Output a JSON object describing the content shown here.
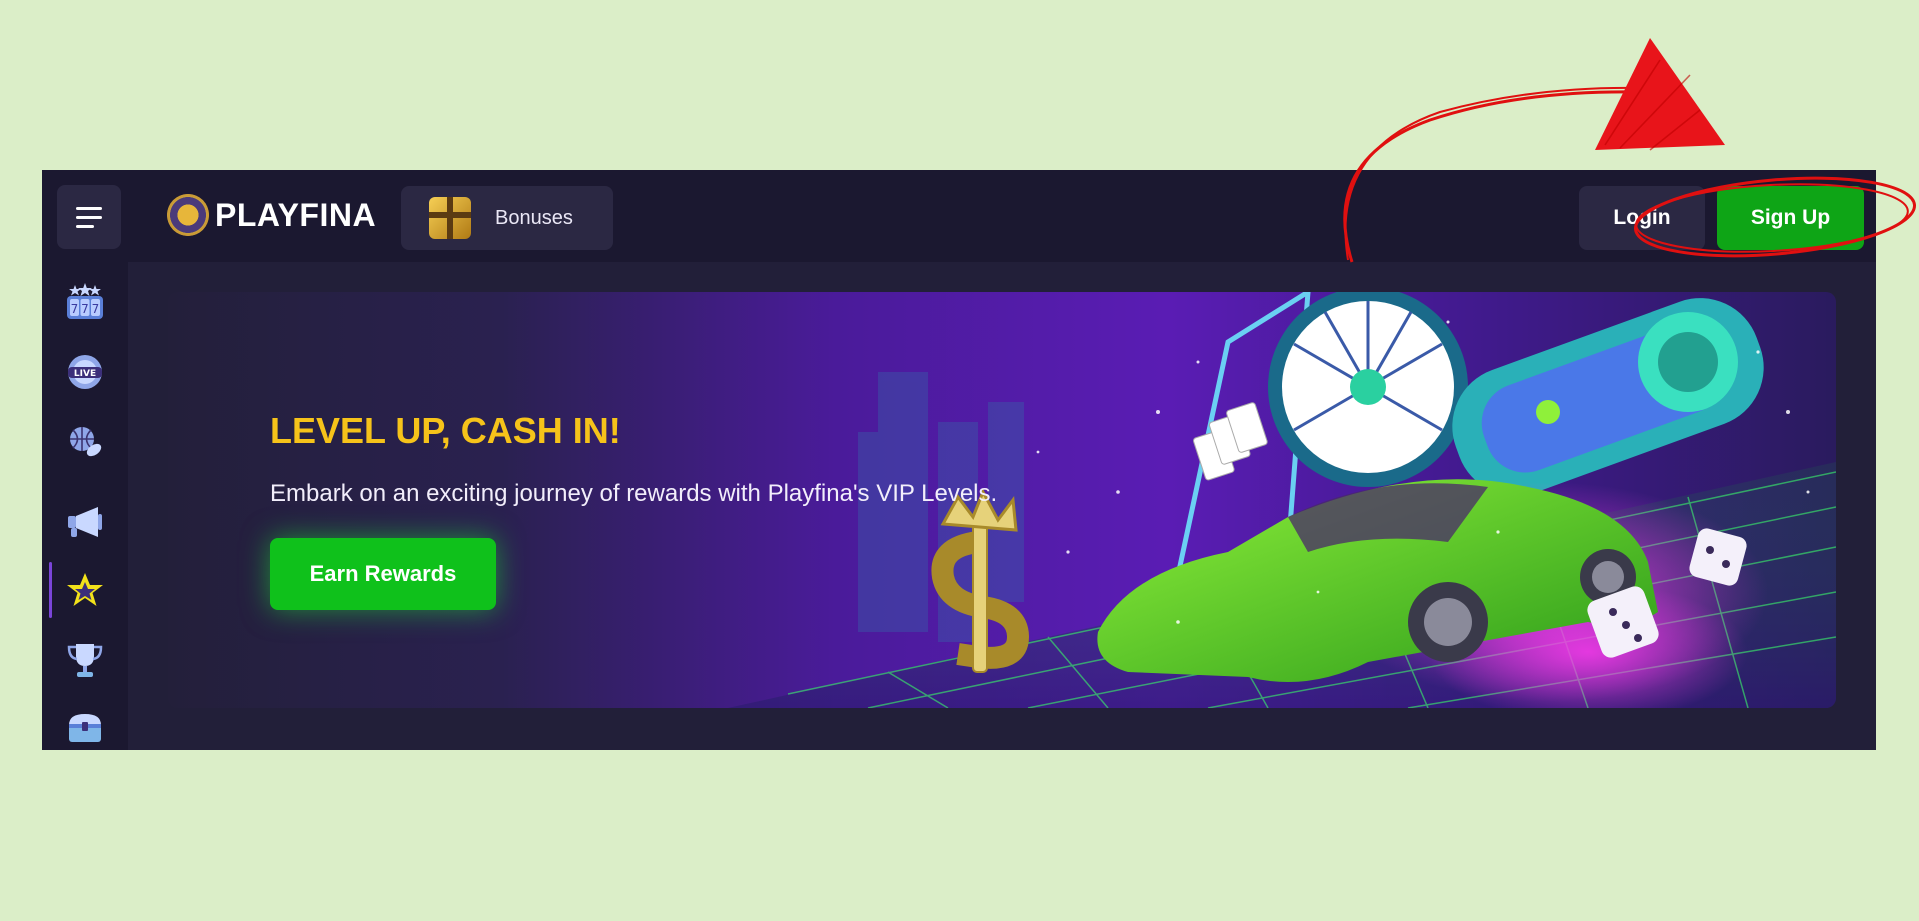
{
  "header": {
    "menu_icon": "hamburger-menu-icon",
    "logo_text": "PLAYFINA",
    "bonuses_label": "Bonuses",
    "login_label": "Login",
    "signup_label": "Sign Up"
  },
  "sidebar": {
    "items": [
      {
        "icon": "slots-777-icon"
      },
      {
        "icon": "live-casino-icon"
      },
      {
        "icon": "sports-ball-icon"
      },
      {
        "icon": "megaphone-icon"
      },
      {
        "icon": "star-vip-icon",
        "active": true
      },
      {
        "icon": "trophy-icon"
      },
      {
        "icon": "treasure-chest-icon"
      }
    ]
  },
  "banner": {
    "title": "LEVEL UP, CASH IN!",
    "subtitle": "Embark on an exciting journey of rewards with Playfina's VIP Levels.",
    "cta_label": "Earn Rewards"
  },
  "colors": {
    "page_background": "#dbeec8",
    "app_background": "#1b1830",
    "button_background": "#2b2843",
    "signup_green": "#0ea516",
    "title_yellow": "#f6c31a",
    "annotation_red": "#e01010"
  }
}
